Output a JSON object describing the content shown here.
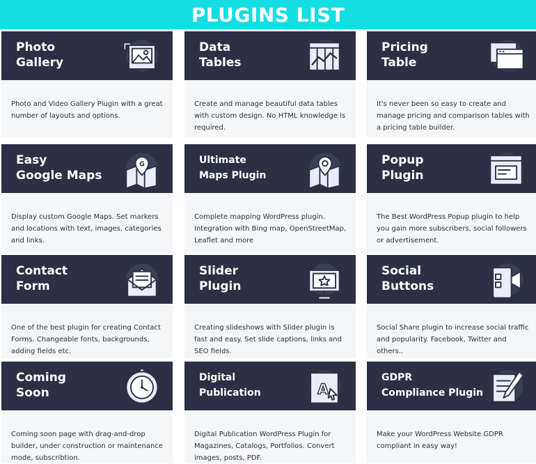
{
  "header": {
    "title": "PLUGINS LIST",
    "bg_color": "#14dde4"
  },
  "colors": {
    "card_header": "#2b3143",
    "card_body": "#f5f6f8",
    "icon_stroke": "#2b3143",
    "icon_fill": "#e9edf7"
  },
  "plugins": [
    {
      "title": [
        "Photo",
        "Gallery"
      ],
      "icon": "photo-gallery-icon",
      "description": "Photo and Video Gallery Plugin with a great number of layouts and options."
    },
    {
      "title": [
        "Data",
        "Tables"
      ],
      "icon": "data-tables-icon",
      "description": "Create and manage beautiful data tables with custom design. No HTML knowledge is required."
    },
    {
      "title": [
        "Pricing",
        "Table"
      ],
      "icon": "pricing-table-icon",
      "description": "It's never been so easy to create and manage pricing and comparison tables with a pricing table builder."
    },
    {
      "title": [
        "Easy",
        "Google Maps"
      ],
      "icon": "google-maps-icon",
      "description": "Display custom Google Maps. Set markers and locations with text, images, categories and links."
    },
    {
      "title": [
        "Ultimate",
        "Maps Plugin"
      ],
      "icon": "maps-icon",
      "description": "Complete mapping WordPress plugin. Integration with Bing map, OpenStreetMap, Leaflet and more"
    },
    {
      "title": [
        "Popup",
        "Plugin"
      ],
      "icon": "popup-icon",
      "description": "The Best WordPress Popup plugin to help you gain more subscribers, social followers or advertisement."
    },
    {
      "title": [
        "Contact",
        "Form"
      ],
      "icon": "contact-form-icon",
      "description": "One of the best plugin for creating Contact Forms. Changeable fonts, backgrounds, adding fields etc."
    },
    {
      "title": [
        "Slider",
        "Plugin"
      ],
      "icon": "slider-icon",
      "description": "Creating slideshows with Slider plugin is fast and easy. Set slide captions, links and SEO fields."
    },
    {
      "title": [
        "Social",
        "Buttons"
      ],
      "icon": "social-buttons-icon",
      "description": "Social Share plugin to increase social traffic and popularity. Facebook, Twitter and others.."
    },
    {
      "title": [
        "Coming",
        "Soon"
      ],
      "icon": "coming-soon-icon",
      "description": "Coming soon page with drag-and-drop builder, under construction or maintenance mode, subscribtion."
    },
    {
      "title": [
        "Digital",
        "Publication"
      ],
      "icon": "digital-publication-icon",
      "description": "Digital Publication WordPress Plugin for Magazines, Catalogs, Portfolios. Convert images, posts, PDF."
    },
    {
      "title": [
        "GDPR",
        "Compliance Plugin"
      ],
      "icon": "gdpr-icon",
      "description": "Make your WordPress Website GDPR compliant in easy way!"
    }
  ]
}
